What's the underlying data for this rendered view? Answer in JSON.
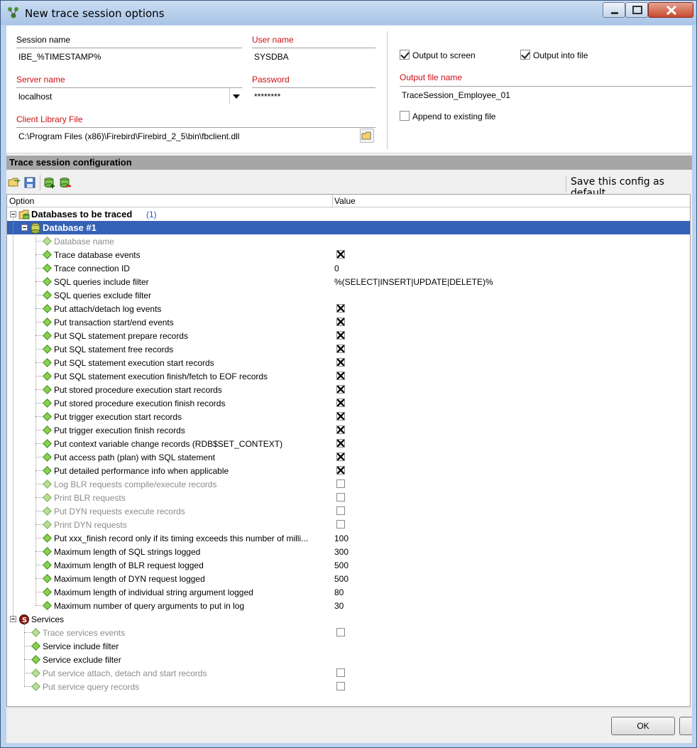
{
  "window": {
    "title": "New trace session options"
  },
  "session": {
    "session_name_label": "Session name",
    "session_name_value": "IBE_%TIMESTAMP%",
    "user_name_label": "User name",
    "user_name_value": "SYSDBA",
    "server_name_label": "Server name",
    "server_name_value": "localhost",
    "password_label": "Password",
    "password_value": "********",
    "client_lib_label": "Client Library File",
    "client_lib_value": "C:\\Program Files (x86)\\Firebird\\Firebird_2_5\\bin\\fbclient.dll"
  },
  "output": {
    "to_screen_label": "Output to screen",
    "to_screen_checked": true,
    "into_file_label": "Output into file",
    "into_file_checked": true,
    "file_name_label": "Output file name",
    "file_name_value": "TraceSession_Employee_01",
    "append_label": "Append to existing file",
    "append_checked": false
  },
  "config": {
    "section_title": "Trace session configuration",
    "save_default_label": "Save this config as default",
    "columns": {
      "option": "Option",
      "value": "Value"
    }
  },
  "tree": {
    "databases": {
      "label": "Databases to be traced",
      "count": "(1)"
    },
    "database1": {
      "label": "Database #1"
    },
    "db_rows": [
      {
        "label": "Database name",
        "kind": "text",
        "value": "",
        "gray": true
      },
      {
        "label": "Trace database events",
        "kind": "check",
        "value": true,
        "gray": false
      },
      {
        "label": "Trace connection ID",
        "kind": "text",
        "value": "0",
        "gray": false
      },
      {
        "label": "SQL queries include filter",
        "kind": "text",
        "value": "%(SELECT|INSERT|UPDATE|DELETE)%",
        "gray": false
      },
      {
        "label": "SQL queries exclude filter",
        "kind": "text",
        "value": "",
        "gray": false
      },
      {
        "label": "Put attach/detach log events",
        "kind": "check",
        "value": true,
        "gray": false
      },
      {
        "label": "Put transaction start/end events",
        "kind": "check",
        "value": true,
        "gray": false
      },
      {
        "label": "Put SQL statement prepare records",
        "kind": "check",
        "value": true,
        "gray": false
      },
      {
        "label": "Put SQL statement free records",
        "kind": "check",
        "value": true,
        "gray": false
      },
      {
        "label": "Put SQL statement execution start records",
        "kind": "check",
        "value": true,
        "gray": false
      },
      {
        "label": "Put SQL statement execution finish/fetch to EOF records",
        "kind": "check",
        "value": true,
        "gray": false
      },
      {
        "label": "Put stored procedure execution start records",
        "kind": "check",
        "value": true,
        "gray": false
      },
      {
        "label": "Put stored procedure execution finish records",
        "kind": "check",
        "value": true,
        "gray": false
      },
      {
        "label": "Put trigger execution start records",
        "kind": "check",
        "value": true,
        "gray": false
      },
      {
        "label": "Put trigger execution finish records",
        "kind": "check",
        "value": true,
        "gray": false
      },
      {
        "label": "Put context variable change records (RDB$SET_CONTEXT)",
        "kind": "check",
        "value": true,
        "gray": false
      },
      {
        "label": "Put access path (plan) with SQL statement",
        "kind": "check",
        "value": true,
        "gray": false
      },
      {
        "label": "Put detailed performance info when applicable",
        "kind": "check",
        "value": true,
        "gray": false
      },
      {
        "label": "Log BLR requests compile/execute records",
        "kind": "check",
        "value": false,
        "gray": true
      },
      {
        "label": "Print BLR requests",
        "kind": "check",
        "value": false,
        "gray": true
      },
      {
        "label": "Put DYN requests execute records",
        "kind": "check",
        "value": false,
        "gray": true
      },
      {
        "label": "Print DYN requests",
        "kind": "check",
        "value": false,
        "gray": true
      },
      {
        "label": "Put xxx_finish record only if its timing exceeds this number of milli...",
        "kind": "text",
        "value": "100",
        "gray": false
      },
      {
        "label": "Maximum length of SQL strings logged",
        "kind": "text",
        "value": "300",
        "gray": false
      },
      {
        "label": "Maximum length of BLR request logged",
        "kind": "text",
        "value": "500",
        "gray": false
      },
      {
        "label": "Maximum length of DYN request logged",
        "kind": "text",
        "value": "500",
        "gray": false
      },
      {
        "label": "Maximum length of individual string argument logged",
        "kind": "text",
        "value": "80",
        "gray": false
      },
      {
        "label": "Maximum number of query arguments to put in log",
        "kind": "text",
        "value": "30",
        "gray": false
      }
    ],
    "services": {
      "label": "Services"
    },
    "svc_rows": [
      {
        "label": "Trace services events",
        "kind": "check",
        "value": false,
        "gray": true
      },
      {
        "label": "Service include filter",
        "kind": "text",
        "value": "",
        "gray": false
      },
      {
        "label": "Service exclude filter",
        "kind": "text",
        "value": "",
        "gray": false
      },
      {
        "label": "Put service attach, detach and start records",
        "kind": "check",
        "value": false,
        "gray": true
      },
      {
        "label": "Put service query records",
        "kind": "check",
        "value": false,
        "gray": true
      }
    ]
  },
  "buttons": {
    "ok": "OK"
  },
  "colors": {
    "selection": "#3561b7",
    "required_label": "#cc1016",
    "section_header": "#a6a6a6"
  }
}
